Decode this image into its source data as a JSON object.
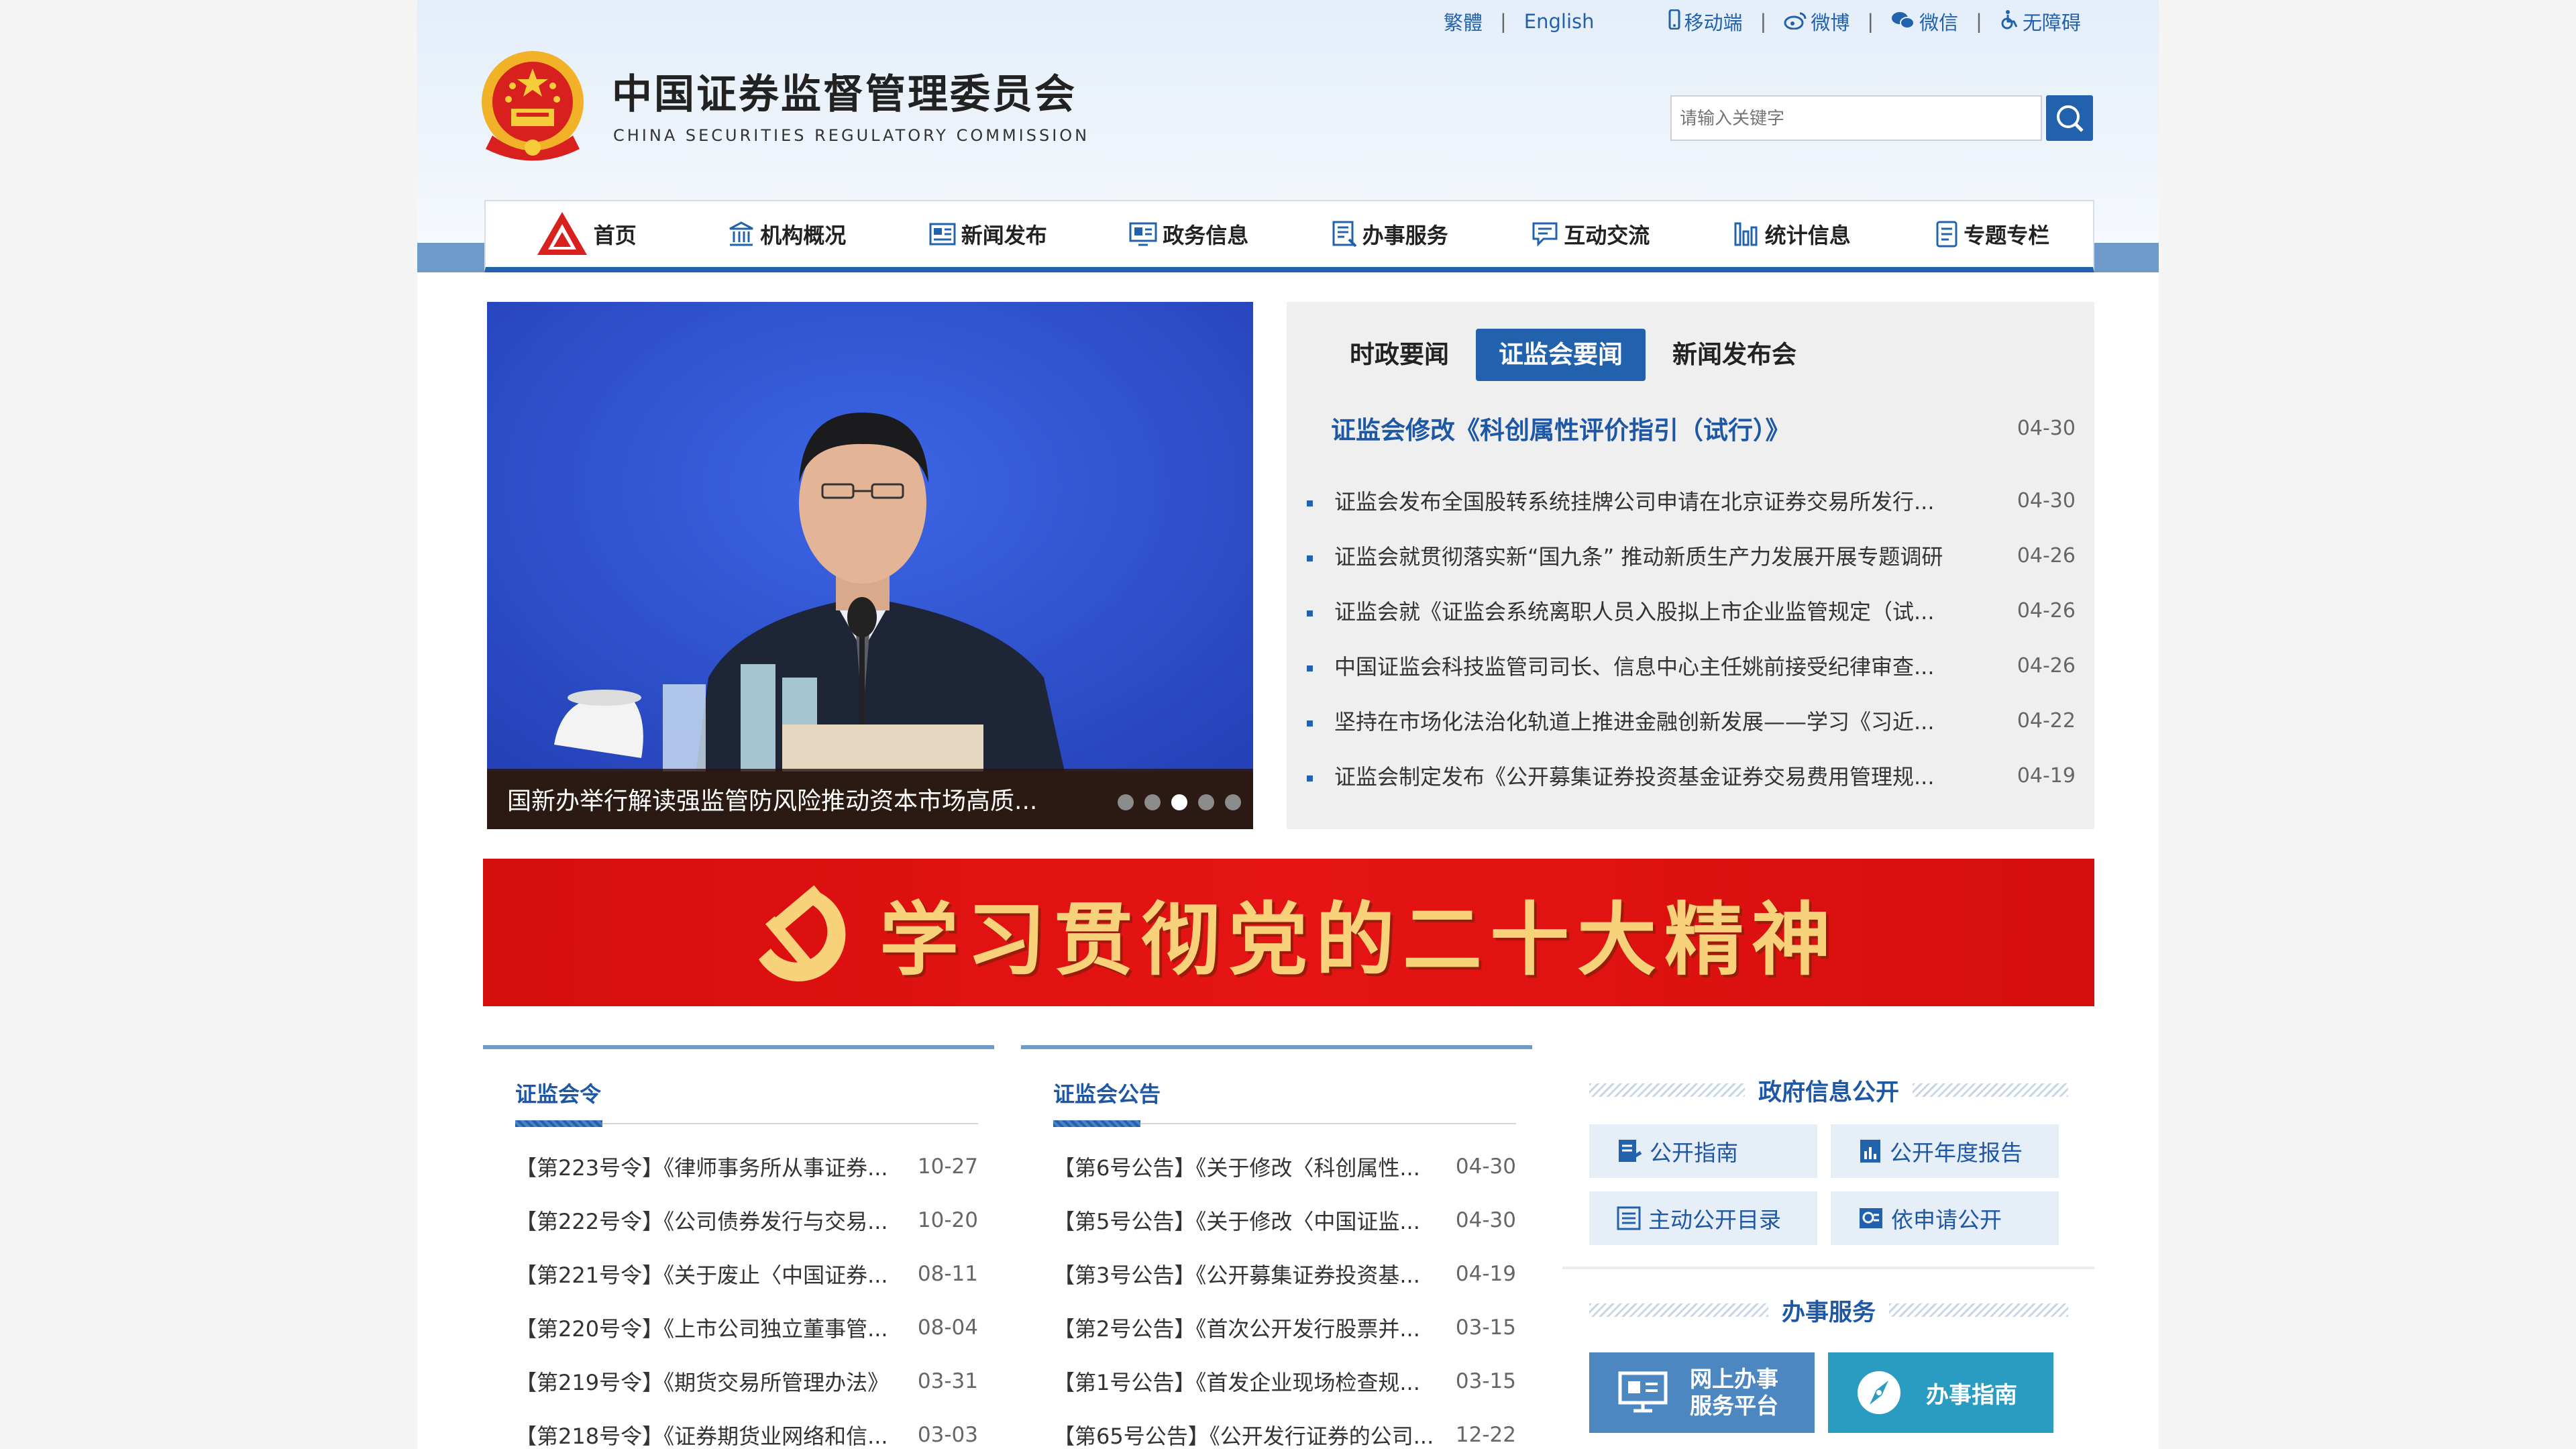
{
  "topbar": {
    "traditional": "繁體",
    "english": "English",
    "mobile": "移动端",
    "weibo": "微博",
    "wechat": "微信",
    "accessibility": "无障碍",
    "sep": "|"
  },
  "logo": {
    "cn": "中国证券监督管理委员会",
    "en": "CHINA SECURITIES REGULATORY COMMISSION"
  },
  "search": {
    "placeholder": "请输入关键字"
  },
  "nav": [
    "首页",
    "机构概况",
    "新闻发布",
    "政务信息",
    "办事服务",
    "互动交流",
    "统计信息",
    "专题专栏"
  ],
  "carousel": {
    "caption": "国新办举行解读强监管防风险推动资本市场高质...",
    "slide_count": 5,
    "active_index": 2
  },
  "news": {
    "tabs": [
      "时政要闻",
      "证监会要闻",
      "新闻发布会"
    ],
    "active_tab": 1,
    "headline": {
      "title": "证监会修改《科创属性评价指引（试行）》",
      "date": "04-30"
    },
    "items": [
      {
        "title": "证监会发布全国股转系统挂牌公司申请在北京证券交易所发行...",
        "date": "04-30"
      },
      {
        "title": "证监会就贯彻落实新“国九条” 推动新质生产力发展开展专题调研",
        "date": "04-26"
      },
      {
        "title": "证监会就《证监会系统离职人员入股拟上市企业监管规定（试...",
        "date": "04-26"
      },
      {
        "title": "中国证监会科技监管司司长、信息中心主任姚前接受纪律审查...",
        "date": "04-26"
      },
      {
        "title": "坚持在市场化法治化轨道上推进金融创新发展——学习《习近...",
        "date": "04-22"
      },
      {
        "title": "证监会制定发布《公开募集证券投资基金证券交易费用管理规...",
        "date": "04-19"
      }
    ]
  },
  "banner": {
    "text": "学习贯彻党的二十大精神"
  },
  "orders": {
    "title": "证监会令",
    "items": [
      {
        "title": "【第223号令】《律师事务所从事证券...",
        "date": "10-27"
      },
      {
        "title": "【第222号令】《公司债券发行与交易...",
        "date": "10-20"
      },
      {
        "title": "【第221号令】《关于废止〈中国证券...",
        "date": "08-11"
      },
      {
        "title": "【第220号令】《上市公司独立董事管...",
        "date": "08-04"
      },
      {
        "title": "【第219号令】《期货交易所管理办法》",
        "date": "03-31"
      },
      {
        "title": "【第218号令】《证券期货业网络和信...",
        "date": "03-03"
      }
    ]
  },
  "announcements": {
    "title": "证监会公告",
    "items": [
      {
        "title": "【第6号公告】《关于修改〈科创属性...",
        "date": "04-30"
      },
      {
        "title": "【第5号公告】《关于修改〈中国证监...",
        "date": "04-30"
      },
      {
        "title": "【第3号公告】《公开募集证券投资基...",
        "date": "04-19"
      },
      {
        "title": "【第2号公告】《首次公开发行股票并...",
        "date": "03-15"
      },
      {
        "title": "【第1号公告】《首发企业现场检查规...",
        "date": "03-15"
      },
      {
        "title": "【第65号公告】《公开发行证券的公司...",
        "date": "12-22"
      }
    ]
  },
  "gov_info": {
    "title": "政府信息公开",
    "buttons": [
      "公开指南",
      "公开年度报告",
      "主动公开目录",
      "依申请公开"
    ]
  },
  "services": {
    "title": "办事服务",
    "platform_line1": "网上办事",
    "platform_line2": "服务平台",
    "guide": "办事指南"
  },
  "colors": {
    "primary": "#2262ad",
    "banner_red": "#e11212",
    "banner_gold": "#f7d27a",
    "nav_band": "#6f9bcb"
  }
}
